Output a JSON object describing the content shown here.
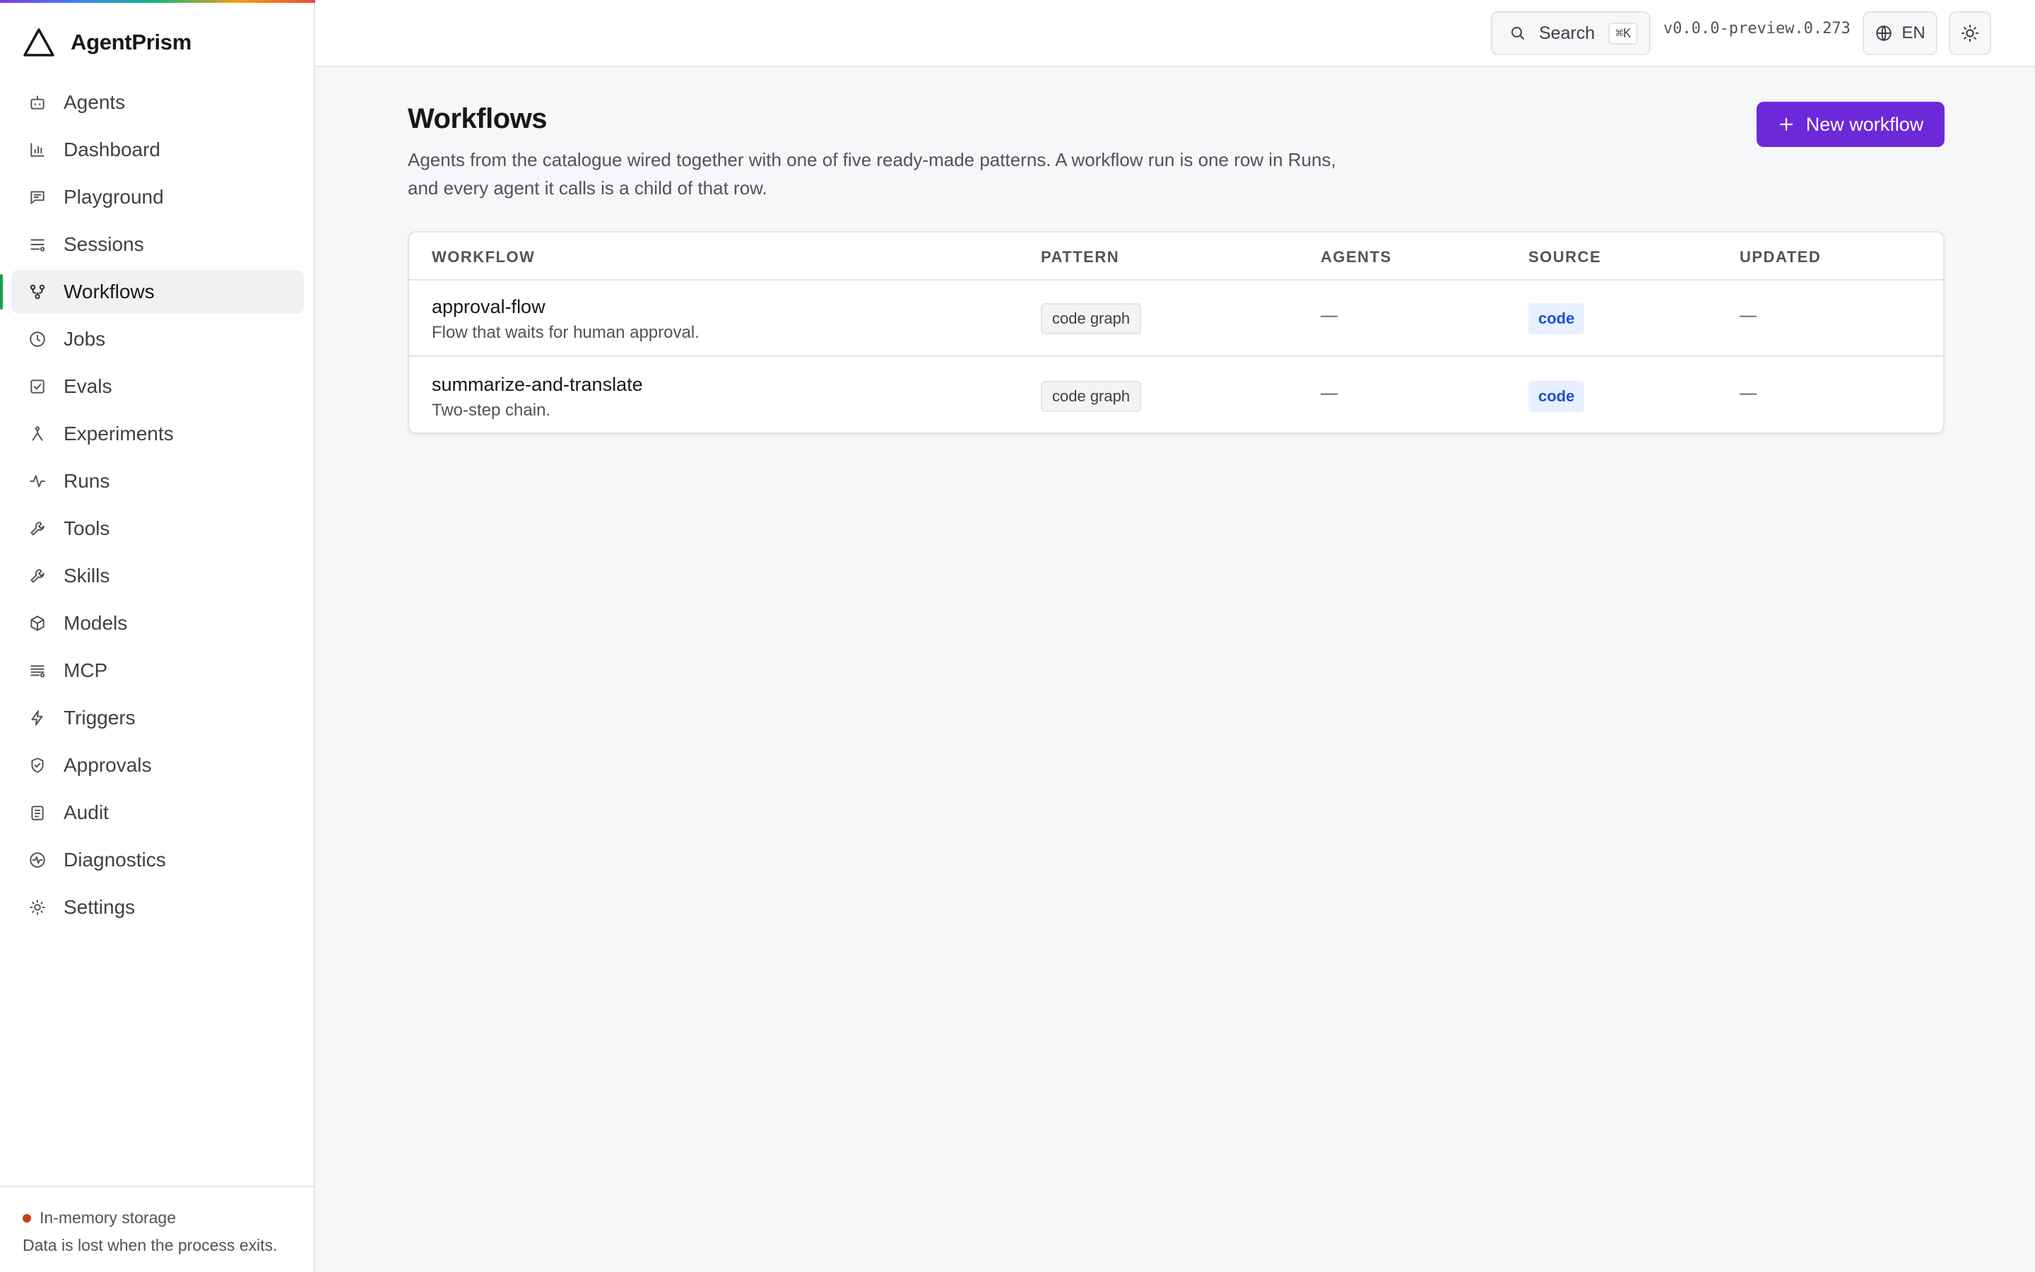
{
  "app": {
    "name": "AgentPrism"
  },
  "sidebar": {
    "items": [
      {
        "label": "Agents",
        "icon": "bot-icon"
      },
      {
        "label": "Dashboard",
        "icon": "bar-chart-icon"
      },
      {
        "label": "Playground",
        "icon": "chat-icon"
      },
      {
        "label": "Sessions",
        "icon": "sessions-list-icon"
      },
      {
        "label": "Workflows",
        "icon": "workflow-icon",
        "active": true
      },
      {
        "label": "Jobs",
        "icon": "clock-icon"
      },
      {
        "label": "Evals",
        "icon": "checkbox-icon"
      },
      {
        "label": "Experiments",
        "icon": "fork-icon"
      },
      {
        "label": "Runs",
        "icon": "activity-icon"
      },
      {
        "label": "Tools",
        "icon": "wrench-icon"
      },
      {
        "label": "Skills",
        "icon": "wrench-icon"
      },
      {
        "label": "Models",
        "icon": "cube-icon"
      },
      {
        "label": "MCP",
        "icon": "server-list-icon"
      },
      {
        "label": "Triggers",
        "icon": "lightning-icon"
      },
      {
        "label": "Approvals",
        "icon": "shield-check-icon"
      },
      {
        "label": "Audit",
        "icon": "clipboard-icon"
      },
      {
        "label": "Diagnostics",
        "icon": "pulse-circle-icon"
      },
      {
        "label": "Settings",
        "icon": "sun-gear-icon"
      }
    ],
    "footer": {
      "status": "In-memory storage",
      "note": "Data is lost when the process exits.",
      "status_color": "#c2410c"
    }
  },
  "topbar": {
    "search_label": "Search",
    "search_shortcut": "⌘K",
    "version": "v0.0.0-preview.0.273",
    "language": "EN"
  },
  "page": {
    "title": "Workflows",
    "description": "Agents from the catalogue wired together with one of five ready-made patterns. A workflow run is one row in Runs, and every agent it calls is a child of that row.",
    "new_button": "New workflow"
  },
  "table": {
    "columns": [
      "WORKFLOW",
      "PATTERN",
      "AGENTS",
      "SOURCE",
      "UPDATED"
    ],
    "rows": [
      {
        "name": "approval-flow",
        "description": "Flow that waits for human approval.",
        "pattern": "code graph",
        "agents": "—",
        "source": "code",
        "updated": "—"
      },
      {
        "name": "summarize-and-translate",
        "description": "Two-step chain.",
        "pattern": "code graph",
        "agents": "—",
        "source": "code",
        "updated": "—"
      }
    ]
  },
  "colors": {
    "accent": "#6d28d9",
    "active_indicator": "#16a34a",
    "source_chip": "#1d4ed8"
  }
}
